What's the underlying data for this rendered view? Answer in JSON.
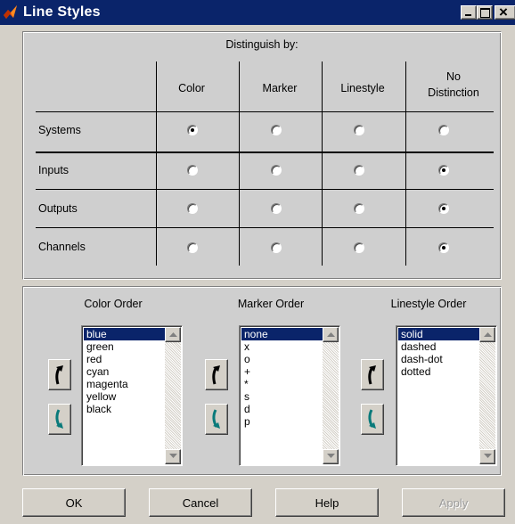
{
  "window": {
    "title": "Line Styles",
    "icon": "matlab-icon",
    "controls": [
      "minimize-icon",
      "maximize-icon",
      "close-icon"
    ]
  },
  "distinguish": {
    "heading": "Distinguish by:",
    "columns": [
      "Color",
      "Marker",
      "Linestyle",
      "No",
      "Distinction"
    ],
    "rows": [
      {
        "label": "Systems",
        "selected": "Color"
      },
      {
        "label": "Inputs",
        "selected": "No Distinction"
      },
      {
        "label": "Outputs",
        "selected": "No Distinction"
      },
      {
        "label": "Channels",
        "selected": "No Distinction"
      }
    ]
  },
  "orders": {
    "color": {
      "label": "Color Order",
      "items": [
        "blue",
        "green",
        "red",
        "cyan",
        "magenta",
        "yellow",
        "black"
      ],
      "selected": "blue"
    },
    "marker": {
      "label": "Marker Order",
      "items": [
        "none",
        "x",
        "o",
        "+",
        "*",
        "s",
        "d",
        "p"
      ],
      "selected": "none"
    },
    "linestyle": {
      "label": "Linestyle Order",
      "items": [
        "solid",
        "dashed",
        "dash-dot",
        "dotted"
      ],
      "selected": "solid"
    }
  },
  "buttons": {
    "ok": "OK",
    "cancel": "Cancel",
    "help": "Help",
    "apply": "Apply",
    "apply_enabled": false
  },
  "colors": {
    "titlebar": "#0a246a",
    "selection": "#0a246a",
    "arrow_up": "#000000",
    "arrow_down": "#0a7a7a"
  }
}
